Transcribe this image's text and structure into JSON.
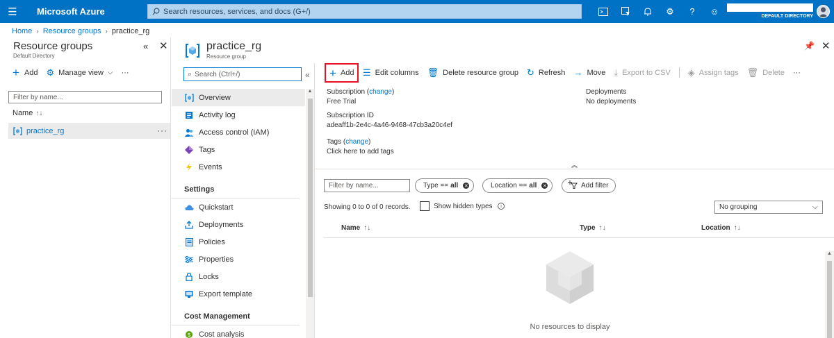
{
  "topbar": {
    "brand": "Microsoft Azure",
    "search_placeholder": "Search resources, services, and docs (G+/)",
    "icons": [
      "cloud-shell-icon",
      "directory-filter-icon",
      "notifications-icon",
      "settings-icon",
      "help-icon",
      "feedback-icon"
    ],
    "directory": "DEFAULT DIRECTORY"
  },
  "breadcrumb": {
    "items": [
      "Home",
      "Resource groups"
    ],
    "current": "practice_rg"
  },
  "left_blade": {
    "title": "Resource groups",
    "subtitle": "Default Directory",
    "add_label": "Add",
    "manage_view_label": "Manage view",
    "more_label": "···",
    "filter_placeholder": "Filter by name...",
    "column_name": "Name",
    "items": [
      {
        "label": "practice_rg"
      }
    ]
  },
  "main": {
    "title": "practice_rg",
    "subtitle": "Resource group",
    "search_placeholder": "Search (Ctrl+/)",
    "menu": {
      "overview": "Overview",
      "activity_log": "Activity log",
      "access_control": "Access control (IAM)",
      "tags": "Tags",
      "events": "Events",
      "settings_header": "Settings",
      "quickstart": "Quickstart",
      "deployments": "Deployments",
      "policies": "Policies",
      "properties": "Properties",
      "locks": "Locks",
      "export_template": "Export template",
      "cost_header": "Cost Management",
      "cost_analysis": "Cost analysis"
    },
    "commands": {
      "add": "Add",
      "edit_columns": "Edit columns",
      "delete_rg": "Delete resource group",
      "refresh": "Refresh",
      "move": "Move",
      "export_csv": "Export to CSV",
      "assign_tags": "Assign tags",
      "delete": "Delete",
      "more": "···"
    },
    "essentials": {
      "subscription_label": "Subscription",
      "change_label": "change",
      "subscription_value": "Free Trial",
      "subscription_id_label": "Subscription ID",
      "subscription_id_value": "adeaff1b-2e4c-4a46-9468-47cb3a20c4ef",
      "tags_label": "Tags",
      "tags_value": "Click here to add tags",
      "deployments_label": "Deployments",
      "deployments_value": "No deployments"
    },
    "filters": {
      "filter_placeholder": "Filter by name...",
      "type_label": "Type ==",
      "type_value": "all",
      "location_label": "Location ==",
      "location_value": "all",
      "add_filter": "Add filter"
    },
    "records_text": "Showing 0 to 0 of 0 records.",
    "show_hidden_label": "Show hidden types",
    "grouping_value": "No grouping",
    "columns": [
      "Name",
      "Type",
      "Location"
    ],
    "empty_text": "No resources to display"
  },
  "colors": {
    "topbar": "#0072c6",
    "accent": "#0078d4",
    "highlight_border": "#e81123"
  }
}
